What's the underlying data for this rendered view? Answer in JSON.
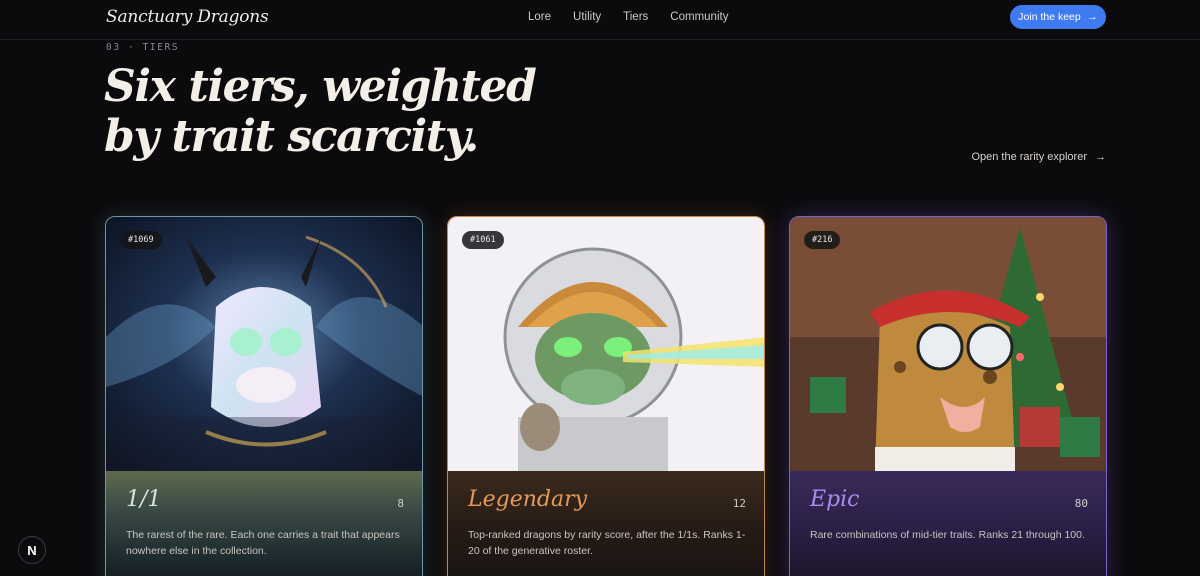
{
  "nav": {
    "brand": "Sanctuary Dragons",
    "links": [
      "Lore",
      "Utility",
      "Tiers",
      "Community"
    ],
    "cta_label": "Join the keep",
    "cta_icon": "arrow-right-icon"
  },
  "hero": {
    "eyebrow": "03 · TIERS",
    "headline": "Six tiers, weighted by trait scarcity.",
    "explorer_label": "Open the rarity explorer",
    "explorer_icon": "arrow-right-icon"
  },
  "cards": [
    {
      "badge": "#1069",
      "tier": "1/1",
      "count": "8",
      "description": "The rarest of the rare. Each one carries a trait that appears nowhere else in the collection.",
      "accent": "#6d97a8"
    },
    {
      "badge": "#1061",
      "tier": "Legendary",
      "count": "12",
      "description": "Top-ranked dragons by rarity score, after the 1/1s. Ranks 1-20 of the generative roster.",
      "accent": "#c58a4c"
    },
    {
      "badge": "#216",
      "tier": "Epic",
      "count": "80",
      "description": "Rare combinations of mid-tier traits. Ranks 21 through 100.",
      "accent": "#7a62c6"
    }
  ],
  "colors": {
    "background": "#0b0a0c",
    "cta_blue": "#3e7bf0"
  },
  "corner_logo": "N"
}
